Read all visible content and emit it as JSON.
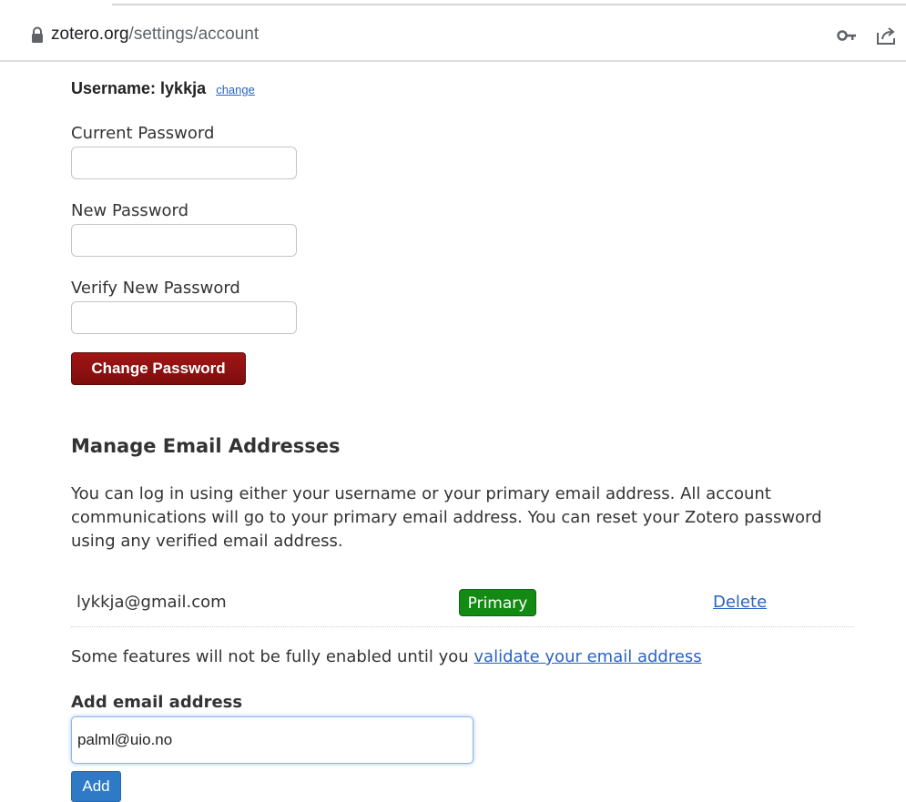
{
  "browser": {
    "url_domain": "zotero.org",
    "url_path": "/settings/account"
  },
  "account": {
    "username_label": "Username: lykkja",
    "change_link": "change",
    "current_password_label": "Current Password",
    "new_password_label": "New Password",
    "verify_password_label": "Verify New Password",
    "change_password_button": "Change Password"
  },
  "email": {
    "heading": "Manage Email Addresses",
    "intro": "You can log in using either your username or your primary email address. All account communications will go to your primary email address. You can reset your Zotero password using any verified email address.",
    "rows": [
      {
        "address": "lykkja@gmail.com",
        "badge": "Primary",
        "action": "Delete"
      }
    ],
    "validate_prefix": "Some features will not be fully enabled until you ",
    "validate_link": "validate your email address",
    "add_heading": "Add email address",
    "add_value": "palml@uio.no",
    "add_button": "Add"
  },
  "colors": {
    "accent_red": "#8b0f0f",
    "primary_green": "#138a13",
    "link_blue": "#2a62c2",
    "button_blue": "#2f7ac7"
  },
  "icons": [
    "lock-icon",
    "key-icon",
    "share-icon"
  ]
}
